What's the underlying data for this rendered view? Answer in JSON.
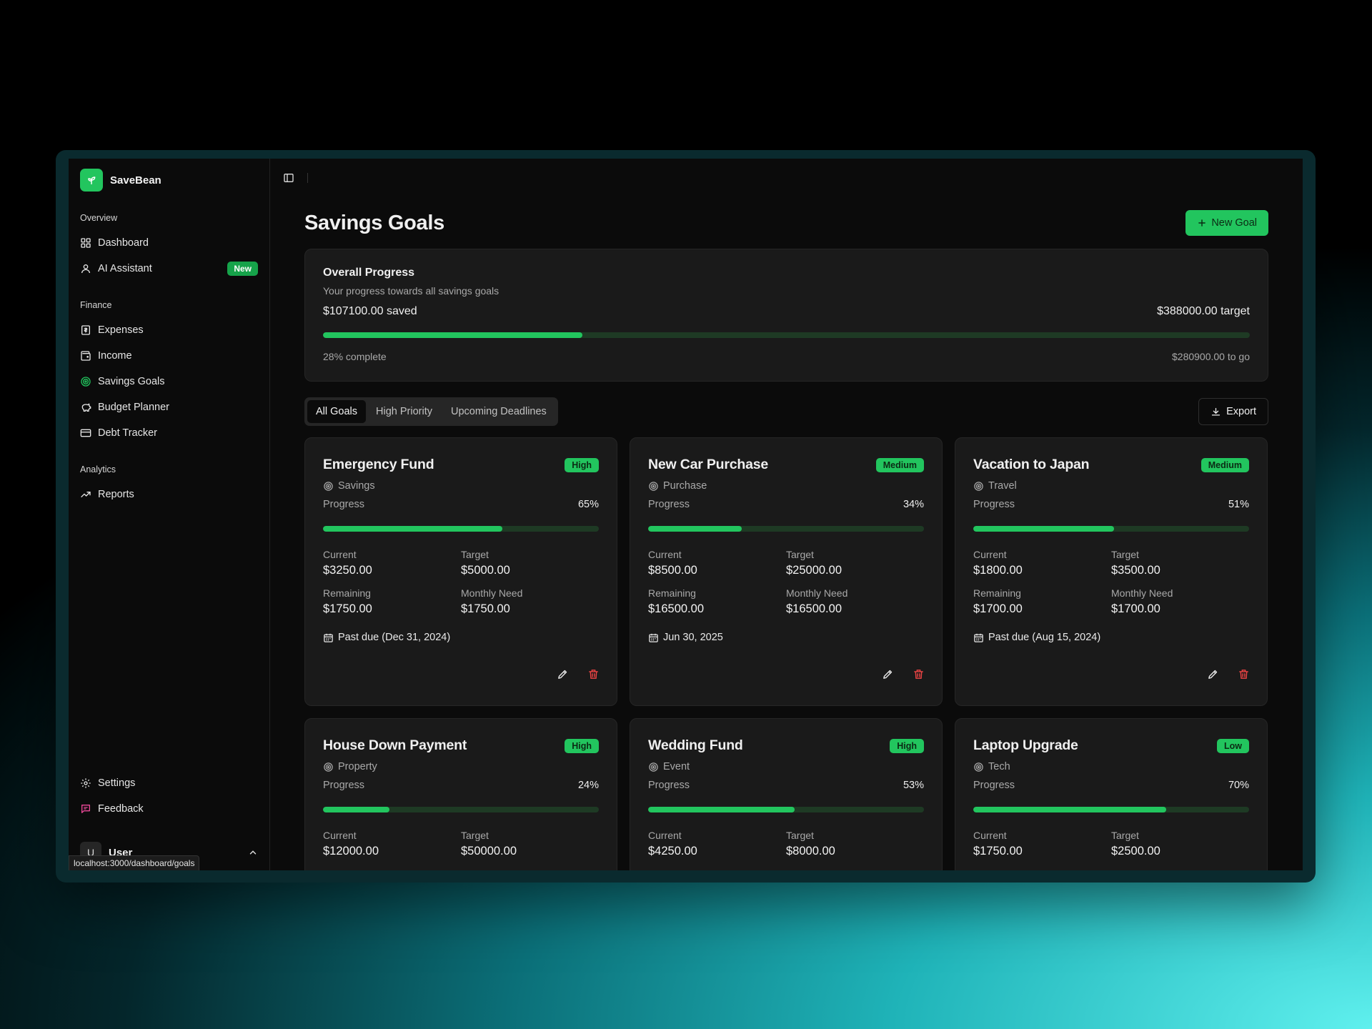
{
  "app": {
    "name": "SaveBean"
  },
  "sidebar": {
    "groups": [
      {
        "label": "Overview",
        "items": [
          {
            "label": "Dashboard",
            "icon": "dashboard-icon"
          },
          {
            "label": "AI Assistant",
            "icon": "user-icon",
            "badge": "New"
          }
        ]
      },
      {
        "label": "Finance",
        "items": [
          {
            "label": "Expenses",
            "icon": "receipt-icon"
          },
          {
            "label": "Income",
            "icon": "wallet-icon"
          },
          {
            "label": "Savings Goals",
            "icon": "target-icon",
            "active": true
          },
          {
            "label": "Budget Planner",
            "icon": "piggy-bank-icon"
          },
          {
            "label": "Debt Tracker",
            "icon": "credit-card-icon"
          }
        ]
      },
      {
        "label": "Analytics",
        "items": [
          {
            "label": "Reports",
            "icon": "trending-up-icon"
          }
        ]
      }
    ],
    "bottom": [
      {
        "label": "Settings",
        "icon": "gear-icon"
      },
      {
        "label": "Feedback",
        "icon": "message-icon"
      }
    ],
    "user": {
      "initial": "U",
      "name": "User"
    },
    "url_tooltip": "localhost:3000/dashboard/goals"
  },
  "page": {
    "title": "Savings Goals",
    "new_button": "New Goal",
    "export_button": "Export"
  },
  "overall": {
    "title": "Overall Progress",
    "subtitle": "Your progress towards all savings goals",
    "saved": "$107100.00 saved",
    "target": "$388000.00 target",
    "percent": 28,
    "complete_text": "28% complete",
    "to_go": "$280900.00 to go"
  },
  "tabs": [
    "All Goals",
    "High Priority",
    "Upcoming Deadlines"
  ],
  "labels": {
    "progress": "Progress",
    "current": "Current",
    "target": "Target",
    "remaining": "Remaining",
    "monthly_need": "Monthly Need"
  },
  "goals": [
    {
      "title": "Emergency Fund",
      "priority": "High",
      "category": "Savings",
      "percent": 65,
      "percent_text": "65%",
      "current": "$3250.00",
      "target": "$5000.00",
      "remaining": "$1750.00",
      "monthly": "$1750.00",
      "due": "Past due (Dec 31, 2024)"
    },
    {
      "title": "New Car Purchase",
      "priority": "Medium",
      "category": "Purchase",
      "percent": 34,
      "percent_text": "34%",
      "current": "$8500.00",
      "target": "$25000.00",
      "remaining": "$16500.00",
      "monthly": "$16500.00",
      "due": "Jun 30, 2025"
    },
    {
      "title": "Vacation to Japan",
      "priority": "Medium",
      "category": "Travel",
      "percent": 51,
      "percent_text": "51%",
      "current": "$1800.00",
      "target": "$3500.00",
      "remaining": "$1700.00",
      "monthly": "$1700.00",
      "due": "Past due (Aug 15, 2024)"
    },
    {
      "title": "House Down Payment",
      "priority": "High",
      "category": "Property",
      "percent": 24,
      "percent_text": "24%",
      "current": "$12000.00",
      "target": "$50000.00"
    },
    {
      "title": "Wedding Fund",
      "priority": "High",
      "category": "Event",
      "percent": 53,
      "percent_text": "53%",
      "current": "$4250.00",
      "target": "$8000.00"
    },
    {
      "title": "Laptop Upgrade",
      "priority": "Low",
      "category": "Tech",
      "percent": 70,
      "percent_text": "70%",
      "current": "$1750.00",
      "target": "$2500.00"
    }
  ],
  "colors": {
    "accent": "#22c55e",
    "danger": "#ef4444",
    "bar_track": "#1e3a24",
    "card": "#1a1a1a"
  }
}
